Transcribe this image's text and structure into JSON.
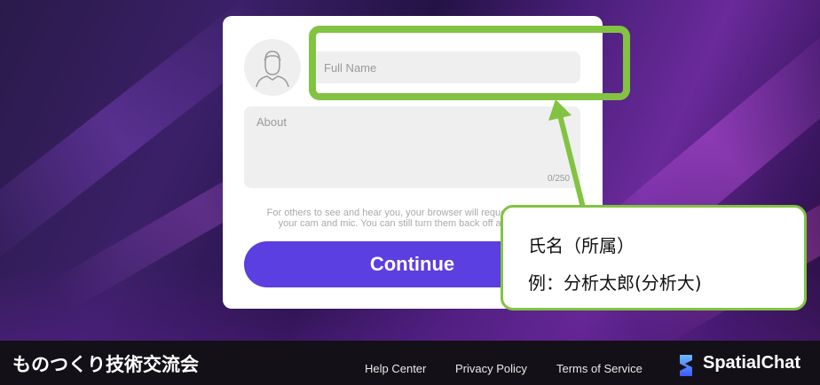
{
  "form": {
    "name_placeholder": "Full Name",
    "about_placeholder": "About",
    "counter": "0/250",
    "notice": "For others to see and hear you, your browser will request access to\nyour cam and mic. You can still turn them back off at any time.",
    "continue_label": "Continue"
  },
  "annotation": {
    "line1": "氏名（所属）",
    "line2": "例：分析太郎(分析大)"
  },
  "footer": {
    "brand": "ものつくり技術交流会",
    "links": [
      "Help Center",
      "Privacy Policy",
      "Terms of Service"
    ],
    "logo_text": "SpatialChat"
  },
  "colors": {
    "accent": "#5b3fe0",
    "highlight": "#82c341",
    "footer_bg": "#141017"
  },
  "icons": {
    "avatar": "user-avatar-icon",
    "logo": "spatialchat-logo-icon"
  }
}
